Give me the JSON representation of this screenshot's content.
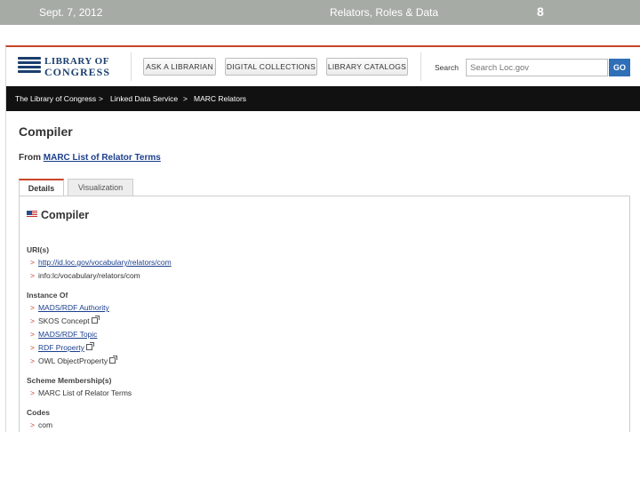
{
  "slide": {
    "date": "Sept. 7, 2012",
    "title": "Relators, Roles & Data",
    "page_number": "8"
  },
  "banner": {
    "logo_line1": "LIBRARY OF",
    "logo_line2": "CONGRESS",
    "nav": [
      "ASK A LIBRARIAN",
      "DIGITAL COLLECTIONS",
      "LIBRARY CATALOGS"
    ],
    "search_label": "Search",
    "search_placeholder": "Search Loc.gov",
    "go_label": "GO"
  },
  "breadcrumb": {
    "items": [
      "The Library of Congress",
      "Linked Data Service",
      "MARC Relators"
    ],
    "separator": ">"
  },
  "page": {
    "title": "Compiler",
    "from_prefix": "From",
    "from_link": "MARC List of Relator Terms"
  },
  "tabs": [
    {
      "label": "Details",
      "active": true
    },
    {
      "label": "Visualization",
      "active": false
    }
  ],
  "record": {
    "title": "Compiler",
    "uris_heading": "URI(s)",
    "uris": [
      "http://id.loc.gov/vocabulary/relators/com",
      "info:lc/vocabulary/relators/com"
    ],
    "instance_heading": "Instance Of",
    "instances": [
      "MADS/RDF Authority",
      "SKOS Concept",
      "MADS/RDF Topic",
      "RDF Property",
      "OWL ObjectProperty"
    ],
    "scheme_heading": "Scheme Membership(s)",
    "schemes": [
      "MARC List of Relator Terms"
    ],
    "codes_heading": "Codes",
    "codes": [
      "com"
    ]
  },
  "colors": {
    "slide_bar": "#a7aba6",
    "accent": "#c8452a",
    "link": "#1b3f8e",
    "go_button": "#2e6fb7",
    "breadcrumb_bg": "#111111"
  }
}
